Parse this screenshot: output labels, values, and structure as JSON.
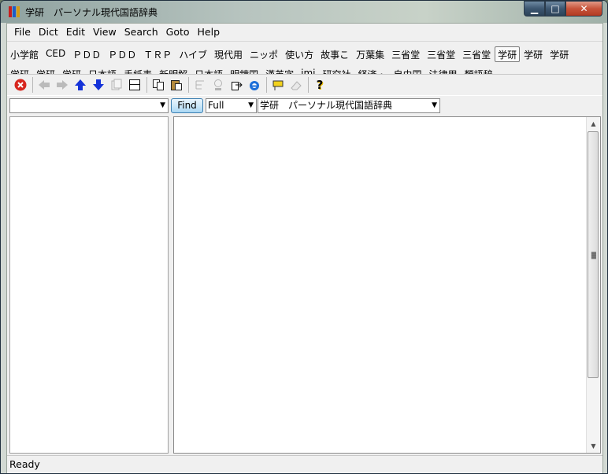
{
  "window": {
    "title": "学研　パーソナル現代国語辞典",
    "minimize": "▁",
    "maximize": "□",
    "close": "✕"
  },
  "menu": [
    "File",
    "Dict",
    "Edit",
    "View",
    "Search",
    "Goto",
    "Help"
  ],
  "dictionaries": {
    "row1": [
      "小学館",
      "CED",
      "ＰＤＤ",
      "ＰＤＤ",
      "ＴＲＰ",
      "ハイブ",
      "現代用",
      "ニッポ",
      "使い方",
      "故事こ",
      "万葉集",
      "三省堂",
      "三省堂",
      "三省堂",
      "学研",
      "学研",
      "学研"
    ],
    "row1_active_index": 14,
    "row2": [
      "学研",
      "学研",
      "学研",
      "日本語",
      "手紙表",
      "新明解",
      "日本語",
      "明鏡国",
      "漢英字",
      "imi",
      "研究社",
      "経済・",
      "自由国",
      "法律用",
      "類語辞"
    ]
  },
  "toolbar": {
    "icons": [
      "stop-icon",
      "back-icon",
      "forward-icon",
      "up-icon",
      "down-icon",
      "copy-page-icon",
      "window-icon",
      "copy-icon",
      "paste-icon",
      "tree-icon",
      "search-web-icon",
      "export-icon",
      "ie-icon",
      "marker-icon",
      "eraser-icon",
      "help-icon"
    ],
    "help_glyph": "?"
  },
  "search": {
    "query": "",
    "find_label": "Find",
    "mode": "Full",
    "dictionary": "学研　パーソナル現代国語辞典"
  },
  "status": {
    "text": "Ready"
  },
  "colors": {
    "find_button": "#cde8f8",
    "close_button": "#c7533a"
  }
}
